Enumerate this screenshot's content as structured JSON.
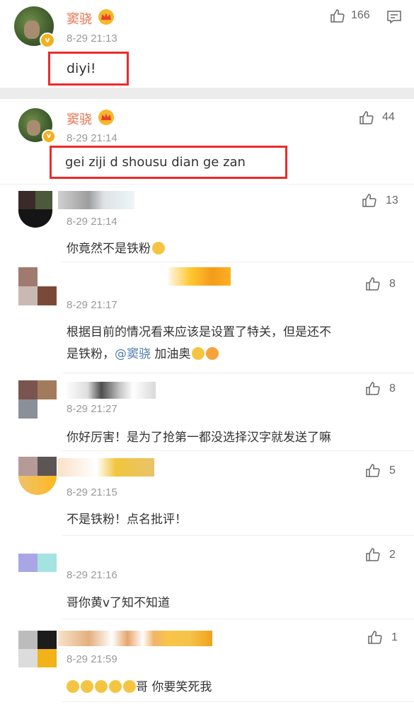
{
  "main_post": {
    "author": "窦骁",
    "time": "8-29 21:13",
    "likes": "166",
    "text": "diyi!"
  },
  "replies": [
    {
      "author": "窦骁",
      "time": "8-29 21:14",
      "likes": "44",
      "text": "gei ziji d shousu dian ge zan"
    },
    {
      "author": "",
      "time": "8-29 21:14",
      "likes": "13",
      "text": "你竟然不是铁粉"
    },
    {
      "author": "",
      "time": "8-29 21:17",
      "likes": "8",
      "text_line1": "根据目前的情况看来应该是设置了特关，但是还不",
      "text_line2a": "是铁粉，",
      "mention": "@窦骁",
      "text_line2b": " 加油奥"
    },
    {
      "author": "",
      "time": "8-29 21:27",
      "likes": "8",
      "text": "你好厉害！是为了抢第一都没选择汉字就发送了嘛"
    },
    {
      "author": "",
      "time": "8-29 21:15",
      "likes": "5",
      "text": "不是铁粉！点名批评！"
    },
    {
      "author": "",
      "time": "8-29 21:16",
      "likes": "2",
      "text": "哥你黄v了知不知道"
    },
    {
      "author": "",
      "time": "8-29 21:59",
      "likes": "1",
      "text": "哥 你要笑死我"
    }
  ],
  "colors": {
    "name": "#eb7350",
    "highlight": "#ee2a2a",
    "mention": "#507daf"
  },
  "icons": [
    "thumb-up-icon",
    "comment-icon",
    "crown-badge-icon",
    "verified-v-icon",
    "laugh-emoji-icon"
  ]
}
